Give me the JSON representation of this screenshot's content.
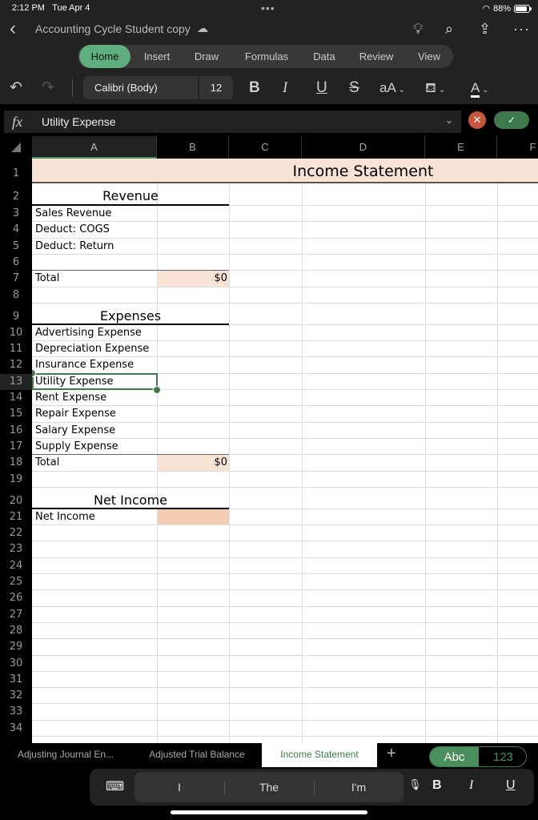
{
  "status_bar": {
    "time": "2:12 PM",
    "date": "Tue Apr 4",
    "battery": "88%"
  },
  "app": {
    "doc_title": "Accounting Cycle Student copy"
  },
  "ribbon_tabs": [
    {
      "label": "Home",
      "active": true
    },
    {
      "label": "Insert"
    },
    {
      "label": "Draw"
    },
    {
      "label": "Formulas"
    },
    {
      "label": "Data"
    },
    {
      "label": "Review"
    },
    {
      "label": "View"
    }
  ],
  "toolbar": {
    "font_name": "Calibri (Body)",
    "font_size": "12",
    "bold": "B",
    "italic": "I",
    "underline": "U",
    "strike": "S",
    "font_size_adjust": "aA"
  },
  "formula_bar": {
    "fx": "fx",
    "value": "Utility Expense"
  },
  "columns": [
    "A",
    "B",
    "C",
    "D",
    "E",
    "F"
  ],
  "selected_cell": "A13",
  "rows": [
    {
      "n": "1",
      "a": "",
      "b": "",
      "title": "Income Statement"
    },
    {
      "n": "2",
      "a": "Revenue",
      "b": ""
    },
    {
      "n": "3",
      "a": "Sales Revenue",
      "b": ""
    },
    {
      "n": "4",
      "a": "Deduct: COGS",
      "b": ""
    },
    {
      "n": "5",
      "a": "Deduct: Return",
      "b": ""
    },
    {
      "n": "6",
      "a": "",
      "b": ""
    },
    {
      "n": "7",
      "a": "Total",
      "b": "$0"
    },
    {
      "n": "8",
      "a": "",
      "b": ""
    },
    {
      "n": "9",
      "a": "Expenses",
      "b": ""
    },
    {
      "n": "10",
      "a": "Advertising Expense",
      "b": ""
    },
    {
      "n": "11",
      "a": "Depreciation Expense",
      "b": ""
    },
    {
      "n": "12",
      "a": "Insurance Expense",
      "b": ""
    },
    {
      "n": "13",
      "a": "Utility Expense",
      "b": ""
    },
    {
      "n": "14",
      "a": "Rent Expense",
      "b": ""
    },
    {
      "n": "15",
      "a": "Repair Expense",
      "b": ""
    },
    {
      "n": "16",
      "a": "Salary Expense",
      "b": ""
    },
    {
      "n": "17",
      "a": "Supply Expense",
      "b": ""
    },
    {
      "n": "18",
      "a": "Total",
      "b": "$0"
    },
    {
      "n": "19",
      "a": "",
      "b": ""
    },
    {
      "n": "20",
      "a": "Net Income",
      "b": ""
    },
    {
      "n": "21",
      "a": "Net Income",
      "b": ""
    },
    {
      "n": "22"
    },
    {
      "n": "23"
    },
    {
      "n": "24"
    },
    {
      "n": "25"
    },
    {
      "n": "26"
    },
    {
      "n": "27"
    },
    {
      "n": "28"
    },
    {
      "n": "29"
    },
    {
      "n": "30"
    },
    {
      "n": "31"
    },
    {
      "n": "32"
    },
    {
      "n": "33"
    },
    {
      "n": "34"
    }
  ],
  "colors": {
    "title_fill": "#f7e2d6",
    "total_fill": "#f7e2d6",
    "net_income_fill": "#f2cdb2",
    "accent": "#3f7a4f"
  },
  "sheet_tabs": [
    {
      "label": "Adjusting Journal En..."
    },
    {
      "label": "Adjusted Trial Balance"
    },
    {
      "label": "Income Statement",
      "active": true
    }
  ],
  "keyboard": {
    "mode_abc": "Abc",
    "mode_123": "123",
    "predictions": [
      "I",
      "The",
      "I'm"
    ],
    "bold": "B",
    "italic": "I",
    "underline": "U"
  }
}
